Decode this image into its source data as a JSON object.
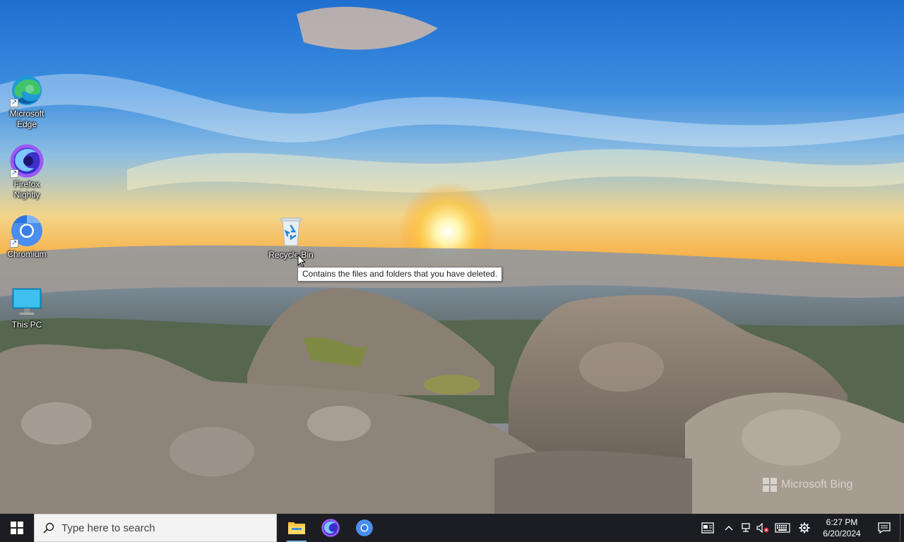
{
  "desktop": {
    "icons": [
      {
        "label": "Microsoft Edge",
        "name": "edge-icon"
      },
      {
        "label": "Firefox Nightly",
        "name": "firefox-nightly-icon"
      },
      {
        "label": "Chromium",
        "name": "chromium-icon"
      },
      {
        "label": "This PC",
        "name": "this-pc-icon"
      },
      {
        "label": "Recycle Bin",
        "name": "recycle-bin-icon"
      }
    ],
    "tooltip": "Contains the files and folders that you have deleted.",
    "watermark": "Microsoft Bing"
  },
  "taskbar": {
    "search_placeholder": "Type here to search",
    "pinned": [
      "file-explorer-icon",
      "firefox-nightly-icon",
      "chromium-icon"
    ],
    "clock_time": "6:27 PM",
    "clock_date": "6/20/2024",
    "colors": {
      "taskbar_bg": "#1c1d22",
      "accent": "#76b9ed"
    }
  }
}
